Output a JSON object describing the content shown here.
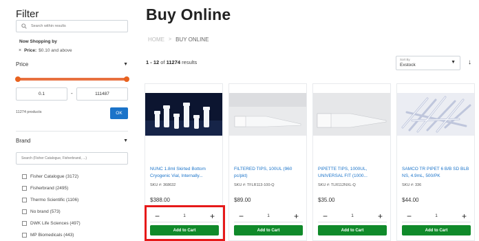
{
  "sidebar": {
    "title": "Filter",
    "search_placeholder": "Search within results",
    "now_shopping_label": "Now Shopping by",
    "active_filter": {
      "remove_icon": "×",
      "name": "Price:",
      "value": "$0.10 and above"
    },
    "price": {
      "label": "Price",
      "min": "0.1",
      "max": "111487",
      "range_separator": "-",
      "product_count": "11274 products",
      "ok_label": "OK"
    },
    "brand": {
      "label": "Brand",
      "search_placeholder": "Search (Fisher Catalogue, Fisherbrand, ...)",
      "items": [
        {
          "label": "Fisher Catalogue (3172)"
        },
        {
          "label": "Fisherbrand (2495)"
        },
        {
          "label": "Thermo Scientific (1106)"
        },
        {
          "label": "No brand (573)"
        },
        {
          "label": "DWK Life Sciences (497)"
        },
        {
          "label": "MP Biomedicals (443)"
        }
      ]
    }
  },
  "main": {
    "title": "Buy Online",
    "breadcrumb": {
      "home": "HOME",
      "separator": ">",
      "current": "BUY ONLINE"
    },
    "results": {
      "range": "1 - 12",
      "of": " of ",
      "total": "11274",
      "suffix": " results"
    },
    "sort": {
      "label": "Sort By",
      "value": "Exstock"
    },
    "products": [
      {
        "name": "NUNC 1.8ml Skirted Bottom Cryogenic Vial, Internally...",
        "sku": "SKU #: 368632",
        "price": "$388.00",
        "qty": "1",
        "add_label": "Add to Cart"
      },
      {
        "name": "FILTERED TIPS, 100UL (960 pc/pkt)",
        "sku": "SKU #: TFLR113-100-Q",
        "price": "$89.00",
        "qty": "1",
        "add_label": "Add to Cart"
      },
      {
        "name": "PIPETTE TIPS, 1000UL, UNIVERSAL FIT (1000...",
        "sku": "SKU #: TLR112NXL-Q",
        "price": "$35.00",
        "qty": "1",
        "add_label": "Add to Cart"
      },
      {
        "name": "SAMCO TR PIPET 6 B/B SD BLB NS, 4.9mL, 500/PK",
        "sku": "SKU #: 336",
        "price": "$44.00",
        "qty": "1",
        "add_label": "Add to Cart"
      }
    ],
    "qty_minus": "−",
    "qty_plus": "+"
  },
  "colors": {
    "link_blue": "#1a73c9",
    "cart_green": "#108a2a",
    "slider_orange": "#e8621f",
    "highlight_red": "#e61919"
  },
  "icons": [
    "search-icon",
    "close-icon",
    "chevron-down-icon",
    "sort-direction-icon",
    "minus-icon",
    "plus-icon"
  ]
}
